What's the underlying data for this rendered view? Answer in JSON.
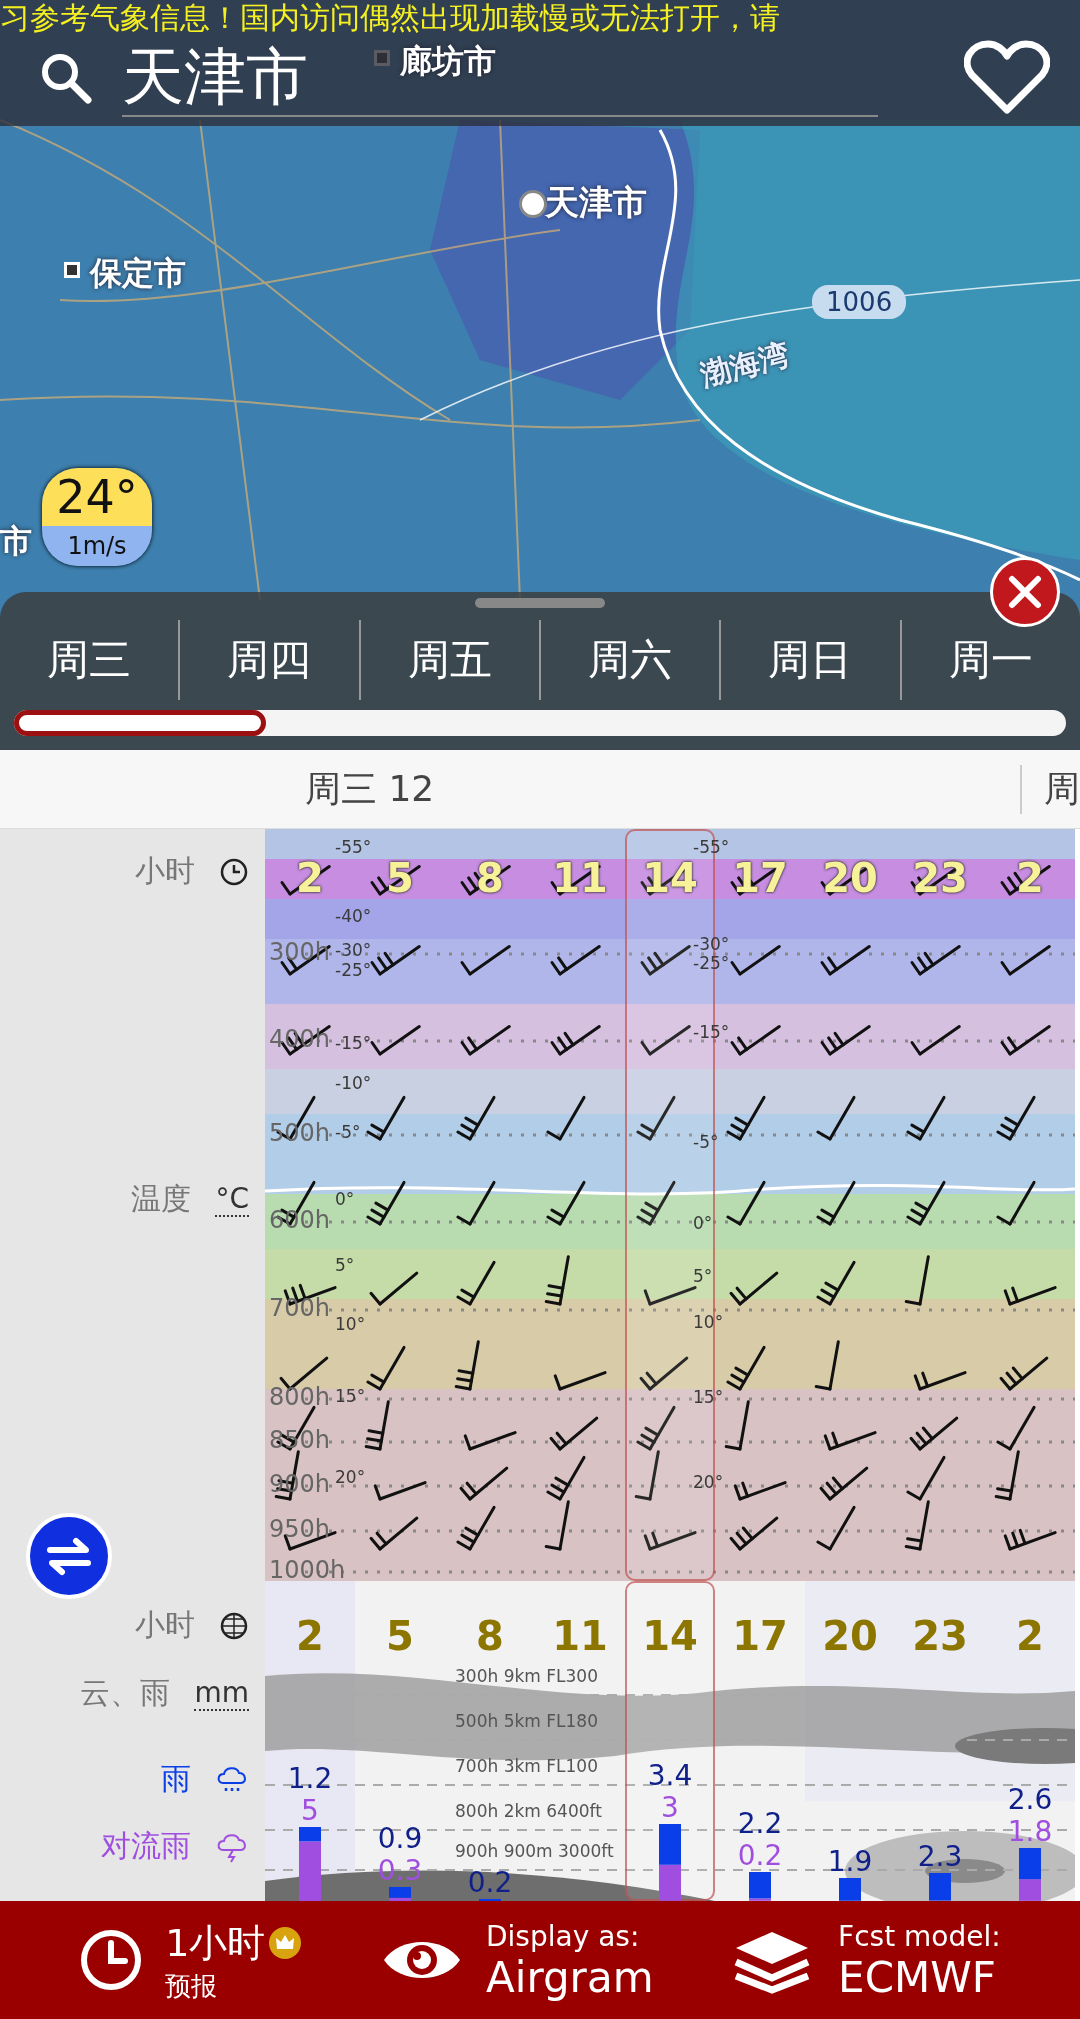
{
  "ticker": "习参考气象信息！国内访问偶然出现加载慢或无法打开，请",
  "header": {
    "title": "天津市"
  },
  "map": {
    "labels": [
      {
        "kind": "city",
        "text": "廊坊市"
      },
      {
        "kind": "current",
        "text": "天津市"
      },
      {
        "kind": "city",
        "text": "保定市"
      },
      {
        "kind": "partial",
        "text": "市"
      },
      {
        "kind": "isobar",
        "text": "1006"
      },
      {
        "kind": "sea",
        "text": "渤海湾"
      }
    ],
    "station": {
      "temperature": "24°",
      "wind": "1m/s"
    }
  },
  "days": {
    "tabs": [
      {
        "label": "周三"
      },
      {
        "label": "周四"
      },
      {
        "label": "周五"
      },
      {
        "label": "周六"
      },
      {
        "label": "周日"
      },
      {
        "label": "周一"
      }
    ],
    "range": {
      "level": 0.24
    }
  },
  "timeline": {
    "day_label": "周三 12",
    "next_day_label": "周"
  },
  "airgram": {
    "hour_label": "小时",
    "temp_label": "温度",
    "temp_unit": "°C",
    "hours": [
      {
        "label": "2",
        "selected": false
      },
      {
        "label": "5",
        "selected": false
      },
      {
        "label": "8",
        "selected": false
      },
      {
        "label": "11",
        "selected": false
      },
      {
        "label": "14",
        "selected": true
      },
      {
        "label": "17",
        "selected": false
      },
      {
        "label": "20",
        "selected": false
      },
      {
        "label": "23",
        "selected": false
      },
      {
        "label": "2",
        "selected": false
      }
    ],
    "pressure_levels": [
      "300h",
      "400h",
      "500h",
      "600h",
      "700h",
      "800h",
      "850h",
      "900h",
      "950h",
      "1000h"
    ],
    "isotherms_left": [
      "-55°",
      "-40°",
      "-30°",
      "-25°",
      "-15°",
      "-10°",
      "-5°",
      "0°",
      "5°",
      "10°",
      "15°",
      "20°"
    ],
    "isotherms_right": [
      "-55°",
      "-30°",
      "-25°",
      "-15°",
      "-5°",
      "0°",
      "5°",
      "10°",
      "15°",
      "20°"
    ]
  },
  "clouds_precip": {
    "hour_label": "小时",
    "precip_label": "云、雨",
    "precip_unit": "mm",
    "altitude_labels": [
      "300h 9km FL300",
      "500h 5km FL180",
      "700h 3km FL100",
      "800h 2km 6400ft",
      "900h 900m 3000ft"
    ],
    "chart_data": {
      "type": "bar",
      "stacked": true,
      "data_labels": true,
      "value_labels": [
        [
          "1.2",
          "0.9",
          "0.2",
          null,
          "3.4",
          "2.2",
          "1.9",
          "2.3",
          "2.6"
        ],
        [
          "5",
          "0.3",
          null,
          null,
          "3",
          "0.2",
          null,
          null,
          "1.8"
        ]
      ],
      "categories": [
        "2",
        "5",
        "8",
        "11",
        "14",
        "17",
        "20",
        "23",
        "2"
      ],
      "series": [
        {
          "name": "雨",
          "color": "#0a3ee8",
          "values": [
            1.2,
            0.9,
            0.2,
            null,
            3.4,
            2.2,
            1.9,
            2.3,
            2.6
          ]
        },
        {
          "name": "对流雨",
          "color": "#a04ee0",
          "values": [
            5,
            0.3,
            null,
            null,
            3,
            0.2,
            null,
            null,
            1.8
          ]
        }
      ]
    }
  },
  "bottom_bar": {
    "items": [
      {
        "kind": "clock",
        "title": "1小时",
        "subtitle": "预报",
        "premium": true
      },
      {
        "kind": "eye",
        "title": "Display as:",
        "subtitle": "Airgram",
        "premium": false
      },
      {
        "kind": "layers",
        "title": "Fcst model:",
        "subtitle": "ECMWF",
        "premium": false
      }
    ]
  }
}
